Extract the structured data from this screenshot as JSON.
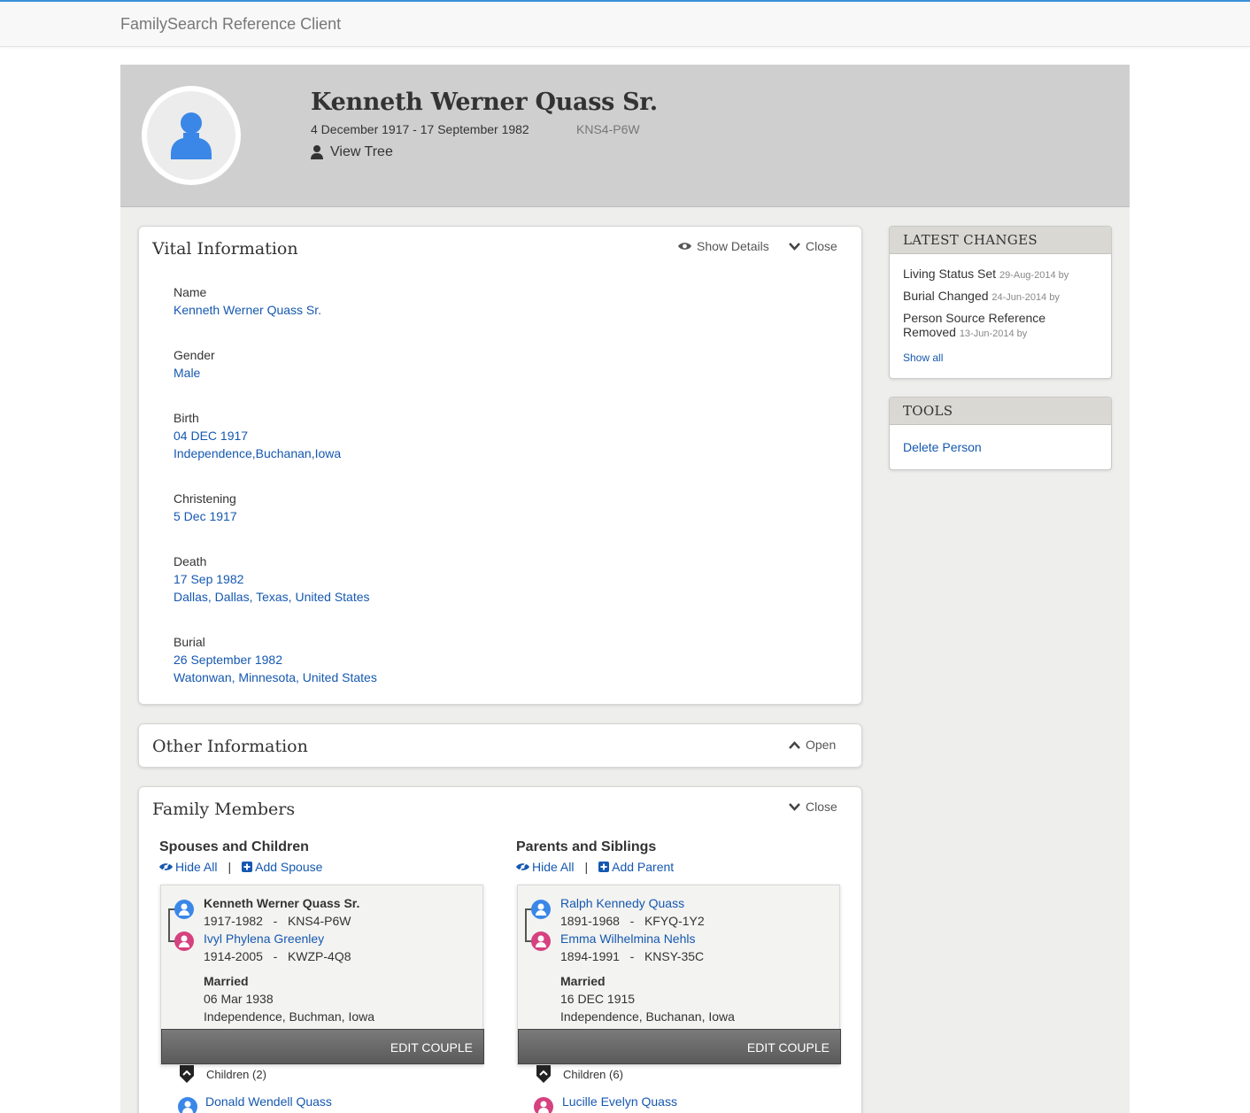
{
  "app": {
    "brand": "FamilySearch Reference Client"
  },
  "person": {
    "name": "Kenneth Werner Quass Sr.",
    "lifespan": "4 December 1917 - 17 September 1982",
    "pid": "KNS4-P6W",
    "view_tree_label": "View Tree"
  },
  "vital": {
    "title": "Vital Information",
    "show_details_label": "Show Details",
    "close_label": "Close",
    "name_label": "Name",
    "name_value": "Kenneth Werner Quass Sr.",
    "gender_label": "Gender",
    "gender_value": "Male",
    "birth_label": "Birth",
    "birth_date": "04 DEC 1917",
    "birth_place": "Independence,Buchanan,Iowa",
    "christening_label": "Christening",
    "christening_date": "5 Dec 1917",
    "death_label": "Death",
    "death_date": "17 Sep 1982",
    "death_place": "Dallas, Dallas, Texas, United States",
    "burial_label": "Burial",
    "burial_date": "26 September 1982",
    "burial_place": "Watonwan, Minnesota, United States"
  },
  "other": {
    "title": "Other Information",
    "open_label": "Open"
  },
  "family": {
    "title": "Family Members",
    "close_label": "Close",
    "spouses": {
      "title": "Spouses and Children",
      "hide_all": "Hide All",
      "separator": "|",
      "add_label": "Add Spouse",
      "husband_name": "Kenneth Werner Quass Sr.",
      "husband_info": "1917-1982   -   KNS4-P6W",
      "wife_name": "Ivyl Phylena Greenley",
      "wife_info": "1914-2005   -   KWZP-4Q8",
      "married_label": "Married",
      "married_date": "06 Mar 1938",
      "married_place": "Independence, Buchman, Iowa",
      "edit_label": "EDIT COUPLE",
      "children_label": "Children (2)",
      "first_child": "Donald Wendell Quass"
    },
    "parents": {
      "title": "Parents and Siblings",
      "hide_all": "Hide All",
      "separator": "|",
      "add_label": "Add Parent",
      "father_name": "Ralph Kennedy Quass",
      "father_info": "1891-1968   -   KFYQ-1Y2",
      "mother_name": "Emma Wilhelmina Nehls",
      "mother_info": "1894-1991   -   KNSY-35C",
      "married_label": "Married",
      "married_date": "16 DEC 1915",
      "married_place": "Independence, Buchanan, Iowa",
      "edit_label": "EDIT COUPLE",
      "children_label": "Children (6)",
      "first_child": "Lucille Evelyn Quass"
    }
  },
  "latest_changes": {
    "title": "LATEST CHANGES",
    "items": [
      {
        "text": "Living Status Set",
        "meta": "29-Aug-2014 by"
      },
      {
        "text": "Burial Changed",
        "meta": "24-Jun-2014 by"
      },
      {
        "text_line1": "Person Source Reference",
        "text_line2": "Removed",
        "meta": "13-Jun-2014 by"
      }
    ],
    "show_all": "Show all"
  },
  "tools": {
    "title": "TOOLS",
    "delete_label": "Delete Person"
  },
  "colors": {
    "link": "#1558b0",
    "male": "#3a87e8",
    "female": "#d6417f",
    "accent": "#3b8fd9"
  }
}
